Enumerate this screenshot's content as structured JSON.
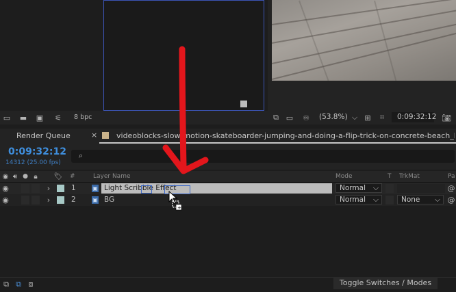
{
  "project_panel": {
    "bit_depth": "8 bpc"
  },
  "viewer": {
    "zoom": "(53.8%)",
    "timecode": "0:09:32:12"
  },
  "tabs": {
    "render_queue": "Render Queue",
    "close_glyph": "×",
    "composition": "videoblocks-slow-motion-skateboarder-jumping-and-doing-a-flip-trick-on-concrete-beach_hbrjuwpco"
  },
  "timeline": {
    "current_time": "0:09:32:12",
    "frame_info": "14312 (25.00 fps)",
    "search_placeholder": ""
  },
  "columns": {
    "number": "#",
    "layer_name": "Layer Name",
    "mode": "Mode",
    "t": "T",
    "trkmat": "TrkMat",
    "parent": "Pa"
  },
  "layers": [
    {
      "index": "1",
      "name": "Light Scribble Effect",
      "mode": "Normal",
      "trkmat": "",
      "selected": true
    },
    {
      "index": "2",
      "name": "BG",
      "mode": "Normal",
      "trkmat": "None",
      "selected": false
    }
  ],
  "footer": {
    "toggle_label": "Toggle Switches / Modes"
  },
  "colors": {
    "accent_blue": "#3f8fde",
    "annotation_red": "#e3161c",
    "label_swatch": "#a7c9c6"
  }
}
